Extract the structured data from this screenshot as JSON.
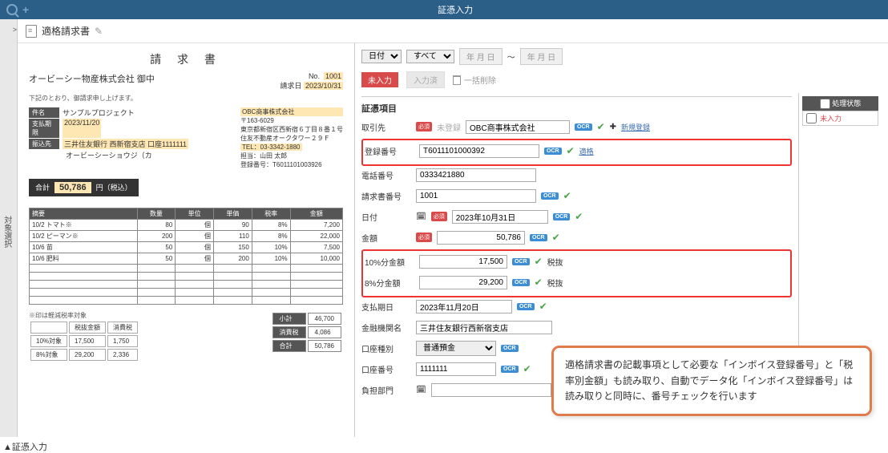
{
  "app": {
    "title": "証憑入力"
  },
  "sidebar": {
    "collapse": ">",
    "label": "対象選択"
  },
  "doc_header": {
    "title": "適格請求書"
  },
  "invoice": {
    "title": "請 求 書",
    "to": "オービーシー物産株式会社 御中",
    "no_label": "No.",
    "no": "1001",
    "date_label": "請求日",
    "date": "2023/10/31",
    "intro": "下記のとおり、御請求申し上げます。",
    "proj_lbl": "件名",
    "proj": "サンプルプロジェクト",
    "due_lbl": "支払期限",
    "due": "2023/11/20",
    "bank_lbl": "振込先",
    "bank": "三井住友銀行 西新宿支店 口座1111111",
    "bank2": "オービーシーショウジ（カ",
    "company": "OBC商事株式会社",
    "postal": "〒163-6029",
    "addr1": "東京都新宿区西新宿６丁目８番１号",
    "addr2": "住友不動産オークタワー２９Ｆ",
    "person": "担当：山田 太郎",
    "reg": "登録番号：T6011101003926",
    "tel": "TEL：03-3342-1880",
    "total_label": "合計",
    "total": "50,786",
    "total_unit": "円（税込）",
    "thead": [
      "摘要",
      "数量",
      "単位",
      "単価",
      "税率",
      "金額"
    ],
    "rows": [
      [
        "10/2 トマト※",
        "80",
        "個",
        "90",
        "8%",
        "7,200"
      ],
      [
        "10/2 ピーマン※",
        "200",
        "個",
        "110",
        "8%",
        "22,000"
      ],
      [
        "10/6 苗",
        "50",
        "個",
        "150",
        "10%",
        "7,500"
      ],
      [
        "10/6 肥料",
        "50",
        "個",
        "200",
        "10%",
        "10,000"
      ]
    ],
    "rate_note": "※印は軽減税率対象",
    "rate_hdr": [
      "",
      "税抜金額",
      "消費税"
    ],
    "rate_rows": [
      [
        "10%対象",
        "17,500",
        "1,750"
      ],
      [
        "8%対象",
        "29,200",
        "2,336"
      ]
    ],
    "sum_rows": [
      [
        "小計",
        "46,700"
      ],
      [
        "消費税",
        "4,086"
      ],
      [
        "合計",
        "50,786"
      ]
    ]
  },
  "filters": {
    "date_label": "日付",
    "all": "すべて",
    "date_ph": "年 月 日",
    "sep": "～"
  },
  "actions": {
    "pending": "未入力",
    "done": "入力済",
    "bulk_delete": "一括削除"
  },
  "form": {
    "section": "証憑項目",
    "partner_lbl": "取引先",
    "partner_unreg": "未登録",
    "partner_val": "OBC商事株式会社",
    "new_reg": "新規登録",
    "regno_lbl": "登録番号",
    "regno_val": "T6011101000392",
    "regno_ok": "適格",
    "tel_lbl": "電話番号",
    "tel_val": "0333421880",
    "invno_lbl": "請求書番号",
    "invno_val": "1001",
    "date_lbl": "日付",
    "date_val": "2023年10月31日",
    "amt_lbl": "金額",
    "amt_val": "50,786",
    "amt10_lbl": "10%分金額",
    "amt10_val": "17,500",
    "tax_excl": "税抜",
    "amt8_lbl": "8%分金額",
    "amt8_val": "29,200",
    "paydate_lbl": "支払期日",
    "paydate_val": "2023年11月20日",
    "bank_lbl": "金融機関名",
    "bank_val": "三井住友銀行西新宿支店",
    "accttype_lbl": "口座種別",
    "accttype_val": "普通預金",
    "acctno_lbl": "口座番号",
    "acctno_val": "1111111",
    "dept_lbl": "負担部門",
    "ocr": "OCR",
    "req": "必須"
  },
  "status": {
    "header": "処理状態",
    "row": "未入力"
  },
  "callout": {
    "text": "適格請求書の記載事項として必要な「インボイス登録番号」と「税率別金額」も読み取り、自動でデータ化「インボイス登録番号」は読み取りと同時に、番号チェックを行います"
  },
  "caption": "▲証憑入力"
}
